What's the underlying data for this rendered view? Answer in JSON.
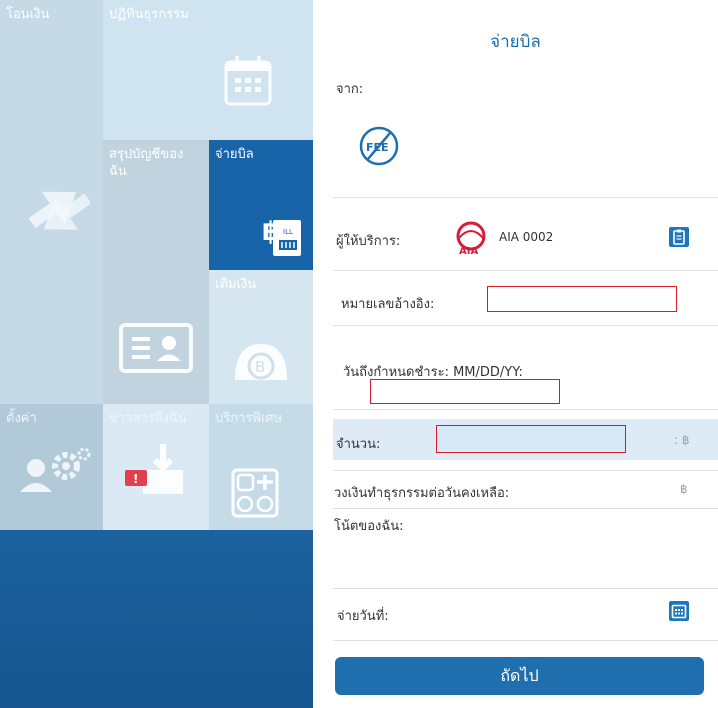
{
  "menu": {
    "transfer": "โอนเงิน",
    "activity": "ปฏิทินธุรกรรม",
    "summary": "สรุปบัญชีของฉัน",
    "paybill": "จ่ายบิล",
    "topup": "เติมเงิน",
    "settings": "ตั้งค่า",
    "news": "ข่าวสารถึงฉัน",
    "services": "บริการพิเศษ",
    "badge": "!"
  },
  "form": {
    "title": "จ่ายบิล",
    "from_label": "จาก:",
    "fee_icon_text": "FEE",
    "provider_label": "ผู้ให้บริการ:",
    "provider_logo_text": "AIA",
    "provider_name": "AIA 0002",
    "reference_label": "หมายเลขอ้างอิง:",
    "due_date_label": "วันถึงกำหนดชำระ: MM/DD/YY:",
    "amount_label": "จำนวน:",
    "amount_unit": ": ฿",
    "daily_limit_label": "วงเงินทำธุรกรรมต่อวันคงเหลือ:",
    "daily_limit_unit": "฿",
    "note_label": "โน้ตของฉัน:",
    "pay_date_label": "จ่ายวันที่:",
    "next_button": "ถัดไป"
  },
  "colors": {
    "accent": "#1f6fae",
    "highlight_box": "#d61c27",
    "amount_band": "#deebf6"
  }
}
